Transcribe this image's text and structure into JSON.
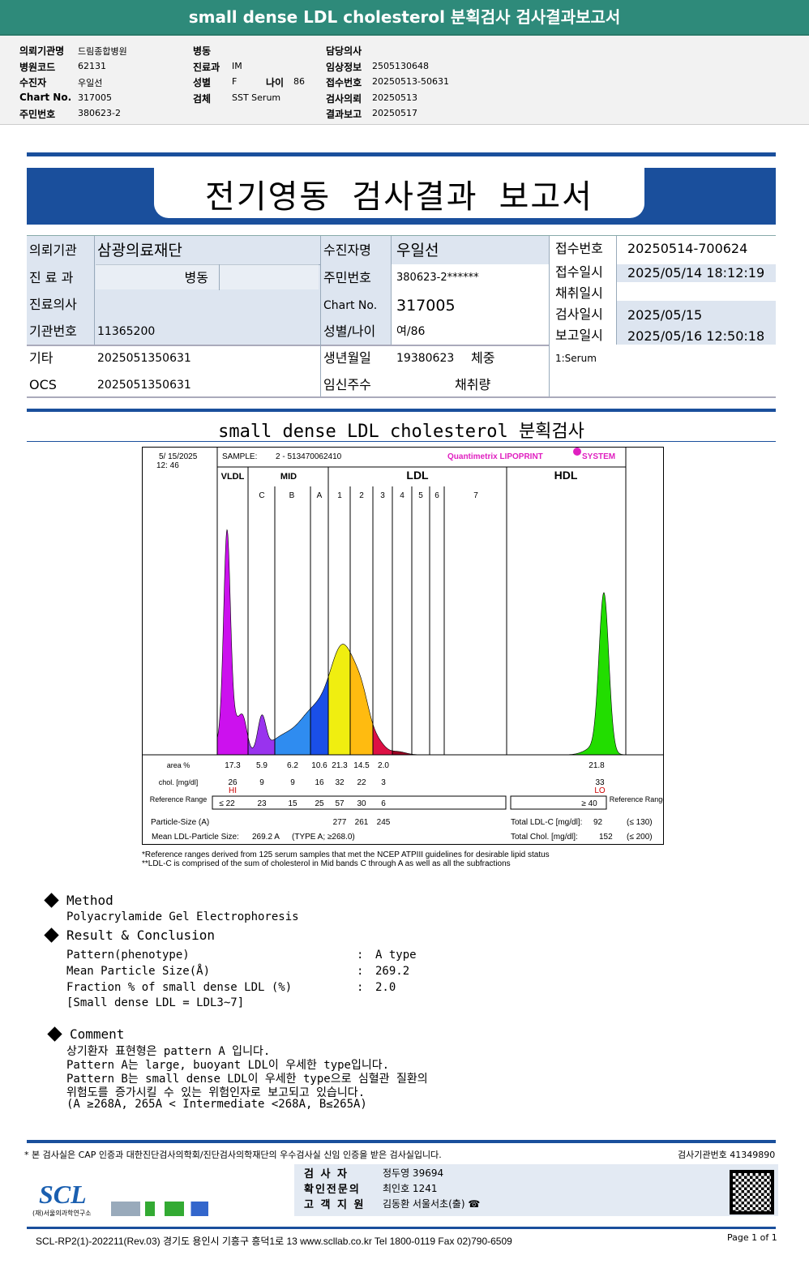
{
  "top_title": "small dense LDL cholesterol 분획검사 검사결과보고서",
  "info": {
    "col1": [
      {
        "label": "의뢰기관명",
        "value": "드림종합병원"
      },
      {
        "label": "병원코드",
        "value": "62131"
      },
      {
        "label": "수진자",
        "value": "우일선"
      },
      {
        "label": "Chart No.",
        "value": "317005"
      },
      {
        "label": "주민번호",
        "value": "380623-2"
      }
    ],
    "col2": [
      {
        "label": "병동",
        "value": ""
      },
      {
        "label": "진료과",
        "value": "IM"
      },
      {
        "label": "성별",
        "value": "F"
      },
      {
        "label": "검체",
        "value": "SST Serum"
      }
    ],
    "age_label": "나이",
    "age_value": "86",
    "col3": [
      {
        "label": "담당의사",
        "value": ""
      },
      {
        "label": "임상정보",
        "value": "2505130648"
      },
      {
        "label": "접수번호",
        "value": "20250513-50631"
      },
      {
        "label": "검사의뢰",
        "value": "20250513"
      },
      {
        "label": "결과보고",
        "value": "20250517"
      }
    ]
  },
  "report_title": "전기영동 검사결과 보고서",
  "report": {
    "org_label": "의뢰기관",
    "org": "삼광의료재단",
    "dept_label": "진 료 과",
    "ward": "병동",
    "doctor_label": "진료의사",
    "inst_label": "기관번호",
    "inst": "11365200",
    "etc_label": "기타",
    "etc": "2025051350631",
    "ocs_label": "OCS",
    "ocs": "2025051350631",
    "name_label": "수진자명",
    "name": "우일선",
    "rrn_label": "주민번호",
    "rrn": "380623-2******",
    "chart_label": "Chart No.",
    "chart": "317005",
    "sexage_label": "성별/나이",
    "sexage": "여/86",
    "birth_label": "생년월일",
    "birth": "19380623",
    "weight_label": "체중",
    "preg_label": "임신주수",
    "vol_label": "채취량",
    "rcpt_no_label": "접수번호",
    "rcpt_no": "20250514-700624",
    "rcpt_dt_label": "접수일시",
    "rcpt_dt": "2025/05/14 18:12:19",
    "coll_label": "채취일시",
    "test_label": "검사일시",
    "test_dt": "2025/05/15",
    "report_label": "보고일시",
    "report_dt": "2025/05/16 12:50:18",
    "specimen": "1:Serum"
  },
  "section_title": "small dense LDL cholesterol 분획검사",
  "lipoprint": {
    "date": "5/ 15/2025",
    "time": "12: 46",
    "sample_label": "SAMPLE:",
    "sample": "2 - 513470062410",
    "brand": "Quantimetrix LIPOPRINT",
    "brand2": "SYSTEM",
    "groups": [
      "VLDL",
      "MID",
      "LDL",
      "HDL"
    ],
    "bands": [
      "C",
      "B",
      "A",
      "1",
      "2",
      "3",
      "4",
      "5",
      "6",
      "7"
    ],
    "row_labels": {
      "area": "area %",
      "chol": "chol. [mg/dl]",
      "ref": "Reference Range",
      "ref_r": "Reference Range",
      "size": "Particle-Size (A)",
      "mean": "Mean LDL-Particle Size:"
    },
    "area": [
      "17.3",
      "5.9",
      "6.2",
      "10.6",
      "21.3",
      "14.5",
      "2.0"
    ],
    "hdl_area": "21.8",
    "chol": [
      "26",
      "9",
      "9",
      "16",
      "32",
      "22",
      "3"
    ],
    "hdl_chol": "33",
    "flag_hi": "HI",
    "flag_lo": "LO",
    "ref": [
      "≤ 22",
      "23",
      "15",
      "25",
      "57",
      "30",
      "6"
    ],
    "hdl_ref": "≥ 40",
    "size": [
      "277",
      "261",
      "245"
    ],
    "mean_size": "269.2 A",
    "mean_type": "(TYPE A; ≥268.0)",
    "total_ldl_label": "Total LDL-C [mg/dl]:",
    "total_ldl": "92",
    "total_ldl_ref": "(≤ 130)",
    "total_chol_label": "Total Chol. [mg/dl]:",
    "total_chol": "152",
    "total_chol_ref": "(≤ 200)",
    "colors": {
      "vldl": "#cc11ee",
      "midc": "#9933ee",
      "midb": "#2f8cf0",
      "mida": "#1a4fe8",
      "ldl1": "#f0ee10",
      "ldl2": "#ffbb10",
      "ldl3": "#dd1144",
      "hdl": "#22dd00"
    }
  },
  "footnotes": [
    "*Reference ranges derived from 125 serum samples that met the NCEP ATPIII guidelines for desirable lipid status",
    "**LDL-C is comprised of the sum of cholesterol in Mid bands C through A as well as all the subfractions"
  ],
  "method": {
    "title": "Method",
    "text": "Polyacrylamide Gel Electrophoresis"
  },
  "result": {
    "title": "Result & Conclusion",
    "rows": [
      {
        "k": "Pattern(phenotype)",
        "v": "A type"
      },
      {
        "k": "Mean Particle Size(Å)",
        "v": "269.2"
      },
      {
        "k": "Fraction % of small dense LDL (%)",
        "v": "2.0"
      }
    ],
    "note": "[Small dense LDL = LDL3~7]"
  },
  "comment": {
    "title": "Comment",
    "lines": [
      "상기환자 표현형은 pattern A 입니다.",
      "Pattern A는 large, buoyant LDL이 우세한 type입니다.",
      "Pattern B는 small dense LDL이 우세한 type으로 심혈관 질환의",
      "위험도를 증가시킬 수 있는 위험인자로 보고되고 있습니다.",
      "(A ≥268A, 265A < Intermediate <268A, B≤265A)"
    ]
  },
  "footer": {
    "cert": "* 본 검사실은 CAP 인증과 대한진단검사의학회/진단검사의학재단의 우수검사실 신임 인증을 받은 검사실입니다.",
    "inst_no": "검사기관번호 41349890",
    "logo": "SCL",
    "logo_sub": "(재)서울의과학연구소",
    "tester_label": "검 사 자",
    "tester": "정두영 39694",
    "confirm_label": "확인전문의",
    "confirm": "최인호 1241",
    "support_label": "고 객 지 원",
    "support": "김동환 서울서초(출) ☎",
    "address": "SCL-RP2(1)-202211(Rev.03) 경기도 용인시 기흥구 흥덕1로 13  www.scllab.co.kr  Tel 1800-0119  Fax 02)790-6509",
    "page": "Page 1 of 1"
  }
}
